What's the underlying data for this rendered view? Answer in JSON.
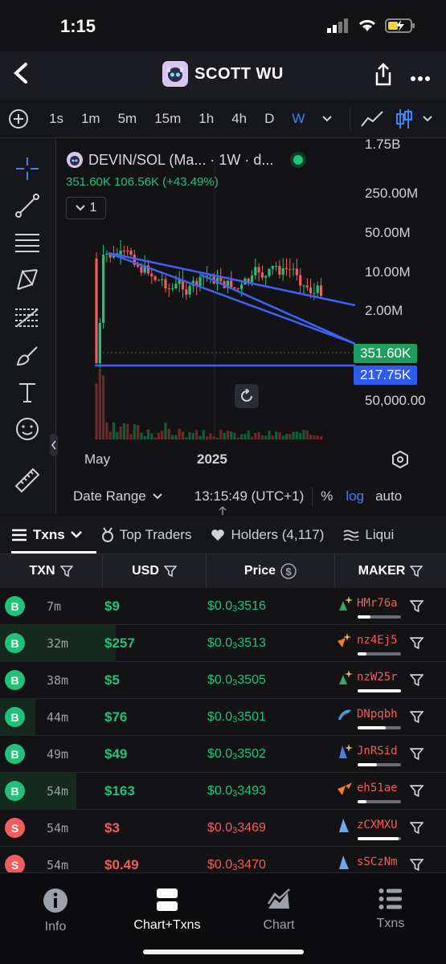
{
  "status": {
    "time": "1:15"
  },
  "header": {
    "title": "SCOTT WU"
  },
  "toolbar": {
    "timeframes": [
      "1s",
      "1m",
      "5m",
      "15m",
      "1h",
      "4h",
      "D",
      "W"
    ],
    "active": "W"
  },
  "chart": {
    "symbol": "DEVIN/SOL (Ma... · 1W · d...",
    "ohlc_line": "351.60K  106.56K (+43.49%)",
    "indicator_count": "1",
    "y_ticks": [
      "1.75B",
      "250.00M",
      "50.00M",
      "10.00M",
      "2.00M",
      "50,000.00"
    ],
    "current_price_label": "351.60K",
    "line_price_label": "217.75K",
    "x_ticks": [
      "May",
      "2025"
    ],
    "date_range_label": "Date Range",
    "clock": "13:15:49 (UTC+1)",
    "pct_label": "%",
    "log_label": "log",
    "auto_label": "auto",
    "colors": {
      "up": "#22c17a",
      "down": "#f05d5d",
      "line": "#3d63f5"
    }
  },
  "tabs": {
    "txns": "Txns",
    "top_traders": "Top Traders",
    "holders": "Holders (4,117)",
    "liquidity": "Liqui"
  },
  "table": {
    "headers": {
      "txn": "TXN",
      "usd": "USD",
      "price": "Price",
      "maker": "MAKER"
    },
    "rows": [
      {
        "type": "B",
        "age": "7m",
        "usd": "$9",
        "price_a": "$0.0",
        "price_sub": "3",
        "price_b": "3516",
        "maker": "HMr76a",
        "bar": 0.3
      },
      {
        "type": "B",
        "age": "32m",
        "usd": "$257",
        "price_a": "$0.0",
        "price_sub": "3",
        "price_b": "3513",
        "maker": "nz4Ej5",
        "bar": 0.2
      },
      {
        "type": "B",
        "age": "38m",
        "usd": "$5",
        "price_a": "$0.0",
        "price_sub": "3",
        "price_b": "3505",
        "maker": "nzW25r",
        "bar": 1.0
      },
      {
        "type": "B",
        "age": "44m",
        "usd": "$76",
        "price_a": "$0.0",
        "price_sub": "3",
        "price_b": "3501",
        "maker": "DNpqbh",
        "bar": 0.65
      },
      {
        "type": "B",
        "age": "49m",
        "usd": "$49",
        "price_a": "$0.0",
        "price_sub": "3",
        "price_b": "3502",
        "maker": "JnRSid",
        "bar": 0.45
      },
      {
        "type": "B",
        "age": "54m",
        "usd": "$163",
        "price_a": "$0.0",
        "price_sub": "3",
        "price_b": "3493",
        "maker": "eh51ae",
        "bar": 0.2
      },
      {
        "type": "S",
        "age": "54m",
        "usd": "$3",
        "price_a": "$0.0",
        "price_sub": "3",
        "price_b": "3469",
        "maker": "zCXMXU",
        "bar": 0.95
      },
      {
        "type": "S",
        "age": "54m",
        "usd": "$0.49",
        "price_a": "$0.0",
        "price_sub": "3",
        "price_b": "3470",
        "maker": "sSCzNm",
        "bar": 0.6
      }
    ]
  },
  "bottom_nav": {
    "info": "Info",
    "chart_txns": "Chart+Txns",
    "chart": "Chart",
    "txns": "Txns"
  }
}
